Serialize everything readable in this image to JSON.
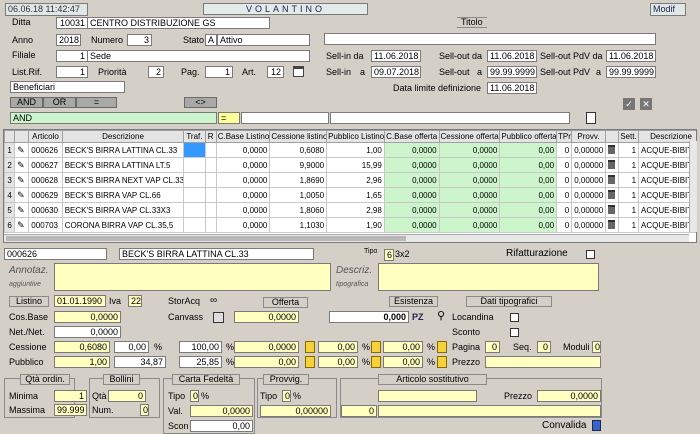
{
  "header": {
    "datetime": "06.06.18 11:42:47",
    "title": "VOLANTINO",
    "mode": "Modif"
  },
  "form": {
    "ditta_label": "Ditta",
    "ditta_code": "10031",
    "ditta_name": "CENTRO DISTRIBUZIONE GS",
    "anno_label": "Anno",
    "anno": "2018",
    "numero_label": "Numero",
    "numero": "3",
    "stato_label": "Stato",
    "stato_code": "A",
    "stato_desc": "Attivo",
    "filiale_label": "Filiale",
    "filiale_code": "1",
    "filiale_name": "Sede",
    "listrif_label": "List.Rif.",
    "listrif": "1",
    "priorita_label": "Priorità",
    "priorita": "2",
    "pag_label": "Pag.",
    "pag": "1",
    "art_label": "Art.",
    "art": "12",
    "beneficiari": "Beneficiari",
    "titolo_label": "Titolo",
    "sellin_da_label": "Sell-in da",
    "sellin_da": "11.06.2018",
    "sellout_da_label": "Sell-out da",
    "sellout_da": "11.06.2018",
    "selloutpdv_da_label": "Sell-out PdV da",
    "selloutpdv_da": "11.06.2018",
    "sellin_a_label": "Sell-in",
    "a_label": "a",
    "sellin_a": "09.07.2018",
    "sellout_a_label": "Sell-out",
    "sellout_a": "99.99.9999",
    "selloutpdv_a_label": "Sell-out PdV",
    "selloutpdv_a": "99.99.9999",
    "datalimite_label": "Data limite definizione",
    "datalimite": "11.06.2018"
  },
  "filter": {
    "and": "AND",
    "or": "OR",
    "eq": "=",
    "ne": "<>",
    "and_field": "AND",
    "eq_field": "="
  },
  "grid": {
    "columns": [
      "",
      "",
      "Articolo",
      "Descrizione",
      "Traf.",
      "R",
      "C.Base Listino",
      "Cessione listino",
      "Pubblico Listino",
      "C.Base offerta",
      "Cessione offerta",
      "Pubblico offerta",
      "TPr",
      "Provv.",
      "",
      "Sett.",
      "Descrizione"
    ],
    "rows": [
      {
        "n": "1",
        "art": "000626",
        "desc": "BECK'S BIRRA LATTINA CL.33",
        "cbl": "0,0000",
        "cel": "0,6080",
        "pul": "1,00",
        "cbo": "0,0000",
        "ceo": "0,0000",
        "puo": "0,00",
        "tpr": "0",
        "prov": "0,00000",
        "sett": "1",
        "sdesc": "ACQUE-BIBITE-B"
      },
      {
        "n": "2",
        "art": "000627",
        "desc": "BECK'S BIRRA LATTINA LT.5",
        "cbl": "0,0000",
        "cel": "9,9000",
        "pul": "15,99",
        "cbo": "0,0000",
        "ceo": "0,0000",
        "puo": "0,00",
        "tpr": "0",
        "prov": "0,00000",
        "sett": "1",
        "sdesc": "ACQUE-BIBITE-B"
      },
      {
        "n": "3",
        "art": "000628",
        "desc": "BECK'S BIRRA NEXT VAP CL.33X3",
        "cbl": "0,0000",
        "cel": "1,8690",
        "pul": "2,96",
        "cbo": "0,0000",
        "ceo": "0,0000",
        "puo": "0,00",
        "tpr": "0",
        "prov": "0,00000",
        "sett": "1",
        "sdesc": "ACQUE-BIBITE-B"
      },
      {
        "n": "4",
        "art": "000629",
        "desc": "BECK'S BIRRA VAP CL.66",
        "cbl": "0,0000",
        "cel": "1,0050",
        "pul": "1,65",
        "cbo": "0,0000",
        "ceo": "0,0000",
        "puo": "0,00",
        "tpr": "0",
        "prov": "0,00000",
        "sett": "1",
        "sdesc": "ACQUE-BIBITE-B"
      },
      {
        "n": "5",
        "art": "000630",
        "desc": "BECK'S BIRRA VAP CL.33X3",
        "cbl": "0,0000",
        "cel": "1,8060",
        "pul": "2,98",
        "cbo": "0,0000",
        "ceo": "0,0000",
        "puo": "0,00",
        "tpr": "0",
        "prov": "0,00000",
        "sett": "1",
        "sdesc": "ACQUE-BIBITE-B"
      },
      {
        "n": "6",
        "art": "000703",
        "desc": "CORONA BIRRA VAP CL.35,5",
        "cbl": "0,0000",
        "cel": "1,1030",
        "pul": "1,90",
        "cbo": "0,0000",
        "ceo": "0,0000",
        "puo": "0,00",
        "tpr": "0",
        "prov": "0,00000",
        "sett": "1",
        "sdesc": "ACQUE-BIBITE-B"
      }
    ]
  },
  "detail": {
    "code": "000626",
    "name": "BECK'S BIRRA LATTINA CL.33",
    "tipo_label": "Tipo",
    "tipo": "6",
    "tipo_desc": "3x2",
    "rifatt_label": "Rifatturazione",
    "annotaz_label": "Annotaz.",
    "annotaz_sub": "aggiuntive",
    "descriz_label": "Descriz.",
    "descriz_sub": "tipografica",
    "listino_label": "Listino",
    "listino_date": "01.01.1990",
    "iva_label": "Iva",
    "iva": "22",
    "storacq_label": "StorAcq",
    "offerta_label": "Offerta",
    "esistenza_label": "Esistenza",
    "datitipo_label": "Dati tipografici",
    "cosbase_label": "Cos.Base",
    "cosbase": "0,0000",
    "canvass_label": "Canvass",
    "canvass": "0,0000",
    "esist_val": "0,000",
    "pz": "PZ",
    "locandina_label": "Locandina",
    "sconto_label": "Sconto",
    "netnet_label": "Net./Net.",
    "netnet": "0,0000",
    "cessione_label": "Cessione",
    "cessione": "0,6080",
    "cess_pct": "0,00",
    "cess_pct2": "100,00",
    "cess_o1": "0,0000",
    "cess_o2": "0,00",
    "cess_o3": "0,00",
    "pubblico_label": "Pubblico",
    "pubblico": "1,00",
    "pub_2": "34,87",
    "pub_pct": "25,85",
    "pub_o1": "0,00",
    "pub_o2": "0,00",
    "pub_o3": "0,00",
    "pagina_label": "Pagina",
    "pagina": "0",
    "seq_label": "Seq.",
    "seq": "0",
    "moduli_label": "Moduli",
    "moduli": "0",
    "prezzo_label": "Prezzo",
    "pct": "%",
    "qta_ordin_label": "Qtà ordin.",
    "bollini_label": "Bollini",
    "cartafed_label": "Carta Fedeltà",
    "provvig_label": "Provvig.",
    "artsost_label": "Articolo sostitutivo",
    "minima_label": "Minima",
    "minima": "1",
    "massima_label": "Massima",
    "massima": "99.999",
    "bqta_label": "Qtà",
    "bqta": "0",
    "bnum_label": "Num.",
    "bnum": "0",
    "cf_tipo_label": "Tipo",
    "cf_tipo": "0",
    "cf_val_label": "Val.",
    "cf_val": "0,0000",
    "cf_scon_label": "Scon",
    "cf_scon": "0,00",
    "pv_tipo_label": "Tipo",
    "pv_tipo": "0",
    "pv_val": "0,00000",
    "as_code": "0",
    "as_prezzo_label": "Prezzo",
    "as_prezzo": "0,0000",
    "convalida_label": "Convalida"
  },
  "colors": {
    "accent": "#3399ff",
    "green": "#ccf5cc",
    "yellow": "#ffffc0",
    "header": "#d4d0c8"
  }
}
